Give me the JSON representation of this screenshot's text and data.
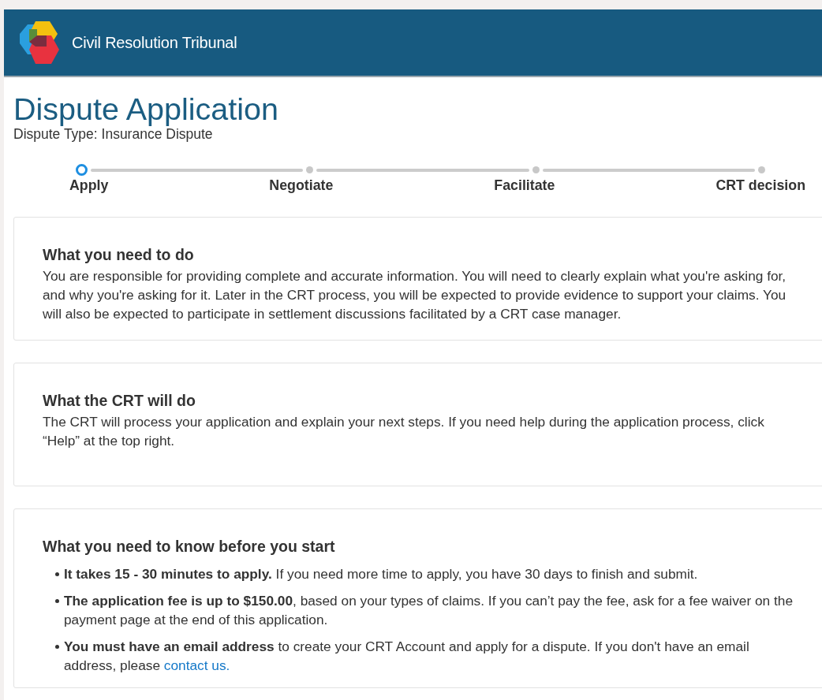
{
  "header": {
    "title": "Civil Resolution Tribunal"
  },
  "page": {
    "title": "Dispute Application",
    "subtitle": "Dispute Type: Insurance Dispute"
  },
  "steps": [
    {
      "label": "Apply",
      "selected": true
    },
    {
      "label": "Negotiate",
      "selected": false
    },
    {
      "label": "Facilitate",
      "selected": false
    },
    {
      "label": "CRT decision",
      "selected": false
    }
  ],
  "cards": [
    {
      "heading": "What you need to do",
      "paragraph": "You are responsible for providing complete and accurate information. You will need to clearly explain what you're asking for, and why you're asking for it. Later in the CRT process, you will be expected to provide evidence to support your claims. You will also be expected to participate in settlement discussions facilitated by a CRT case manager."
    },
    {
      "heading": "What the CRT will do",
      "paragraph": "The CRT will process your application and explain your next steps. If you need help during the application process, click “Help” at the top right."
    },
    {
      "heading": "What you need to know before you start",
      "bullets": [
        {
          "text": "**It takes 15 - 30 minutes to apply.** If you need more time to apply, you have 30 days to finish and submit."
        },
        {
          "text": "**The application fee is up to $150.00**, based on your types of claims. If you can’t pay the fee, ask for a fee waiver on the payment page at the end of this application."
        },
        {
          "text": "**You must have an email address** to create your CRT Account and apply for a dispute. If you don't have an email address, please",
          "link": "contact us."
        }
      ]
    }
  ]
}
